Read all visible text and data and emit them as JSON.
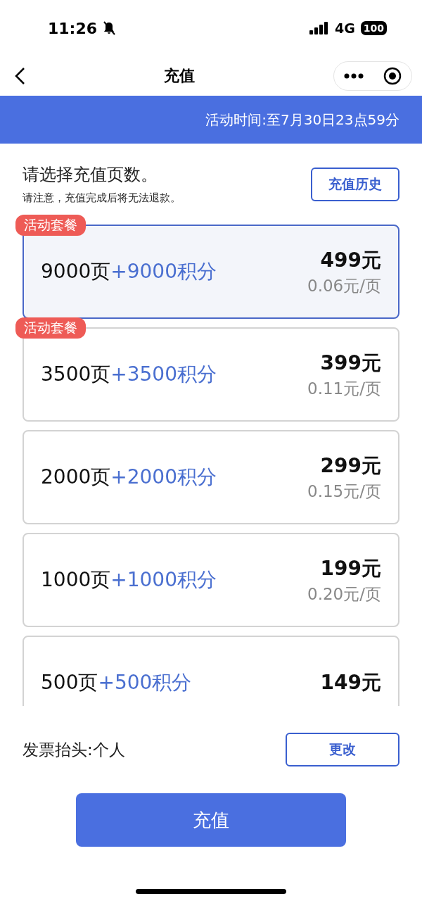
{
  "status_bar": {
    "time": "11:26",
    "network": "4G",
    "battery": "100"
  },
  "nav": {
    "title": "充值"
  },
  "banner": {
    "text": "活动时间:至7月30日23点59分"
  },
  "intro": {
    "heading": "请选择充值页数。",
    "note": "请注意，充值完成后将无法退款。",
    "history_button": "充值历史"
  },
  "packages": [
    {
      "pages": "9000页",
      "bonus": "+9000积分",
      "price": "499元",
      "unit_price": "0.06元/页",
      "badge": "活动套餐",
      "selected": true
    },
    {
      "pages": "3500页",
      "bonus": "+3500积分",
      "price": "399元",
      "unit_price": "0.11元/页",
      "badge": "活动套餐",
      "selected": false
    },
    {
      "pages": "2000页",
      "bonus": "+2000积分",
      "price": "299元",
      "unit_price": "0.15元/页",
      "selected": false
    },
    {
      "pages": "1000页",
      "bonus": "+1000积分",
      "price": "199元",
      "unit_price": "0.20元/页",
      "selected": false
    },
    {
      "pages": "500页",
      "bonus": "+500积分",
      "price": "149元",
      "selected": false
    }
  ],
  "invoice": {
    "label": "发票抬头:个人",
    "change_button": "更改"
  },
  "submit_button": "充值"
}
